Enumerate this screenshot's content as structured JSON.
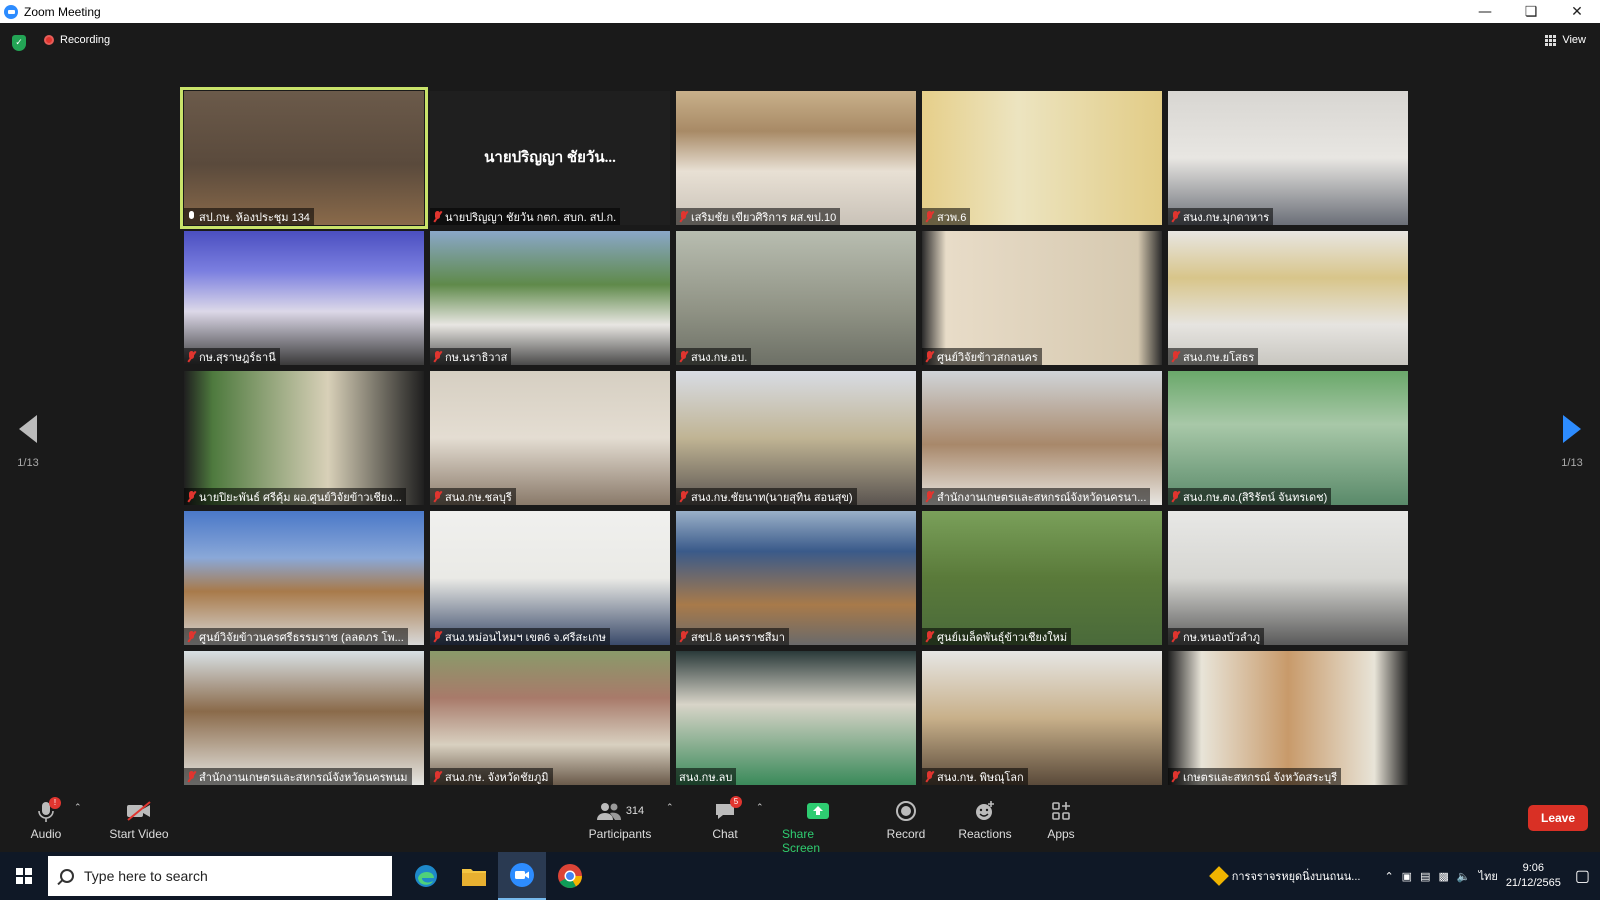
{
  "window": {
    "title": "Zoom Meeting"
  },
  "meeting": {
    "recording_label": "Recording",
    "view_label": "View"
  },
  "pagination": {
    "left_page": "1/13",
    "right_page": "1/13"
  },
  "tiles": [
    {
      "name": "สป.กษ. ห้องประชุม 134",
      "muted": false
    },
    {
      "name": "นายปริญญา ชัยวัน กตก. สบก. สป.ก.",
      "muted": true,
      "display_name": "นายปริญญา ชัยวัน..."
    },
    {
      "name": "เสริมชัย เขียวศิริการ ผส.ขป.10",
      "muted": true
    },
    {
      "name": "สวพ.6",
      "muted": true
    },
    {
      "name": "สนง.กษ.มุกดาหาร",
      "muted": true
    },
    {
      "name": "กษ.สุราษฎร์ธานี",
      "muted": true
    },
    {
      "name": "กษ.นราธิวาส",
      "muted": true
    },
    {
      "name": "สนง.กษ.อบ.",
      "muted": true
    },
    {
      "name": "ศูนย์วิจัยข้าวสกลนคร",
      "muted": true
    },
    {
      "name": "สนง.กษ.ยโสธร",
      "muted": true
    },
    {
      "name": "นายปิยะพันธ์ ศรีคุ้ม ผอ.ศูนย์วิจัยข้าวเชียง...",
      "muted": true
    },
    {
      "name": "สนง.กษ.ชลบุรี",
      "muted": true
    },
    {
      "name": "สนง.กษ.ชัยนาท(นายสุทิน  สอนสุข)",
      "muted": true
    },
    {
      "name": "สำนักงานเกษตรและสหกรณ์จังหวัดนครนา...",
      "muted": true
    },
    {
      "name": "สนง.กษ.ตง.(สิริรัตน์ จันทรเดช)",
      "muted": true
    },
    {
      "name": "ศูนย์วิจัยข้าวนครศรีธรรมราช (ลลดภร โพ...",
      "muted": true
    },
    {
      "name": "สนง.หม่อนไหมฯ เขต6 จ.ศรีสะเกษ",
      "muted": true
    },
    {
      "name": "สชป.8 นครราชสีมา",
      "muted": true
    },
    {
      "name": "ศูนย์เมล็ดพันธุ์ข้าวเชียงใหม่",
      "muted": true
    },
    {
      "name": "กษ.หนองบัวลำภู",
      "muted": true
    },
    {
      "name": "สำนักงานเกษตรและสหกรณ์จังหวัดนครพนม",
      "muted": true
    },
    {
      "name": "สนง.กษ. จังหวัดชัยภูมิ",
      "muted": true
    },
    {
      "name": "สนง.กษ.ลบ",
      "muted": false,
      "noicon": true
    },
    {
      "name": "สนง.กษ. พิษณุโลก",
      "muted": true
    },
    {
      "name": "เกษตรและสหกรณ์ จังหวัดสระบุรี",
      "muted": true
    }
  ],
  "toolbar": {
    "audio": "Audio",
    "audio_badge": "!",
    "start_video": "Start Video",
    "participants": "Participants",
    "participants_count": "314",
    "chat": "Chat",
    "chat_badge": "5",
    "share_screen": "Share Screen",
    "record": "Record",
    "reactions": "Reactions",
    "apps": "Apps",
    "leave": "Leave"
  },
  "taskbar": {
    "search_placeholder": "Type here to search",
    "notification": "การจราจรหยุดนิ่งบนถนน...",
    "language": "ไทย",
    "time": "9:06",
    "date": "21/12/2565"
  },
  "colors": {
    "accent": "#2d8cff",
    "active_border": "#c9e36a",
    "leave": "#d93025",
    "share": "#2ecc71",
    "muted": "#e0352f"
  }
}
